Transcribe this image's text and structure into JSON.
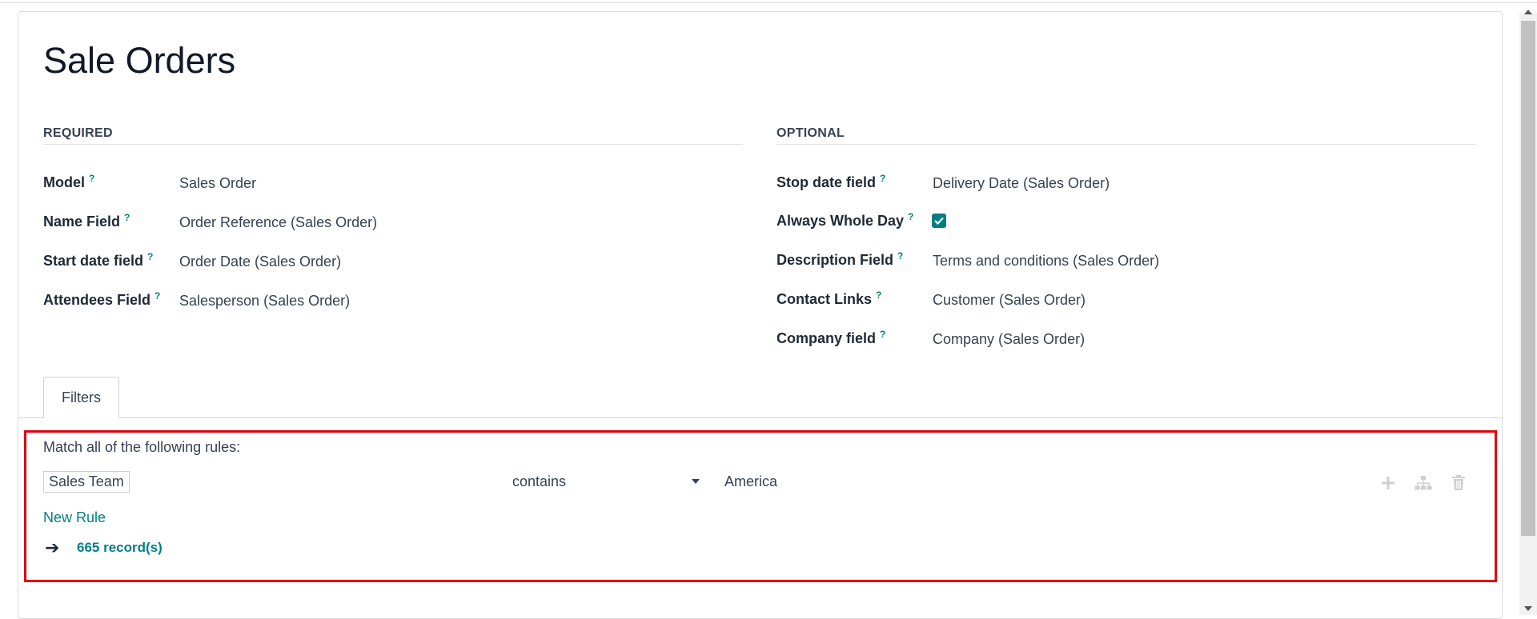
{
  "page": {
    "title": "Sale Orders"
  },
  "required": {
    "heading": "REQUIRED",
    "fields": [
      {
        "label": "Model",
        "help": "?",
        "value": "Sales Order"
      },
      {
        "label": "Name Field",
        "help": "?",
        "value": "Order Reference (Sales Order)"
      },
      {
        "label": "Start date field",
        "help": "?",
        "value": "Order Date (Sales Order)"
      },
      {
        "label": "Attendees Field",
        "help": "?",
        "value": "Salesperson (Sales Order)"
      }
    ]
  },
  "optional": {
    "heading": "OPTIONAL",
    "fields": [
      {
        "label": "Stop date field",
        "help": "?",
        "value": "Delivery Date (Sales Order)"
      },
      {
        "label": "Always Whole Day",
        "help": "?",
        "checked": true
      },
      {
        "label": "Description Field",
        "help": "?",
        "value": "Terms and conditions (Sales Order)"
      },
      {
        "label": "Contact Links",
        "help": "?",
        "value": "Customer (Sales Order)"
      },
      {
        "label": "Company field",
        "help": "?",
        "value": "Company (Sales Order)"
      }
    ]
  },
  "tabs": [
    {
      "label": "Filters",
      "active": true
    }
  ],
  "filters": {
    "match_text": "Match all of the following rules:",
    "rule": {
      "field": "Sales Team",
      "operator": "contains",
      "value": "America"
    },
    "actions": [
      "plus-icon",
      "sitemap-icon",
      "trash-icon"
    ],
    "new_rule_label": "New Rule",
    "records_label": "665 record(s)"
  },
  "colors": {
    "accent": "#017e84",
    "highlight": "#e0000f"
  }
}
